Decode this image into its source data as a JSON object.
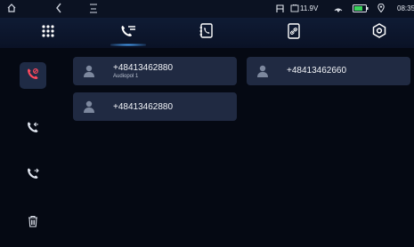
{
  "status": {
    "voltage": "11.9V",
    "time": "08:35"
  },
  "tabs": [
    {
      "name": "keypad",
      "icon": "keypad-icon"
    },
    {
      "name": "calls",
      "icon": "phone-list-icon"
    },
    {
      "name": "contacts",
      "icon": "contacts-icon"
    },
    {
      "name": "phone-link",
      "icon": "phone-link-icon"
    },
    {
      "name": "settings",
      "icon": "settings-icon"
    }
  ],
  "sidebar": [
    {
      "name": "missed-calls",
      "icon": "missed-call-icon",
      "active": true
    },
    {
      "name": "incoming-calls",
      "icon": "incoming-call-icon"
    },
    {
      "name": "outgoing-calls",
      "icon": "outgoing-call-icon"
    },
    {
      "name": "delete",
      "icon": "trash-icon"
    }
  ],
  "calls": [
    {
      "number": "+48413462880",
      "label": "Audiopol  1"
    },
    {
      "number": "+48413462660",
      "label": ""
    },
    {
      "number": "+48413462880",
      "label": ""
    }
  ],
  "colors": {
    "accent": "#4aa6ff",
    "missed": "#ff4a5e",
    "card": "#202a42"
  }
}
